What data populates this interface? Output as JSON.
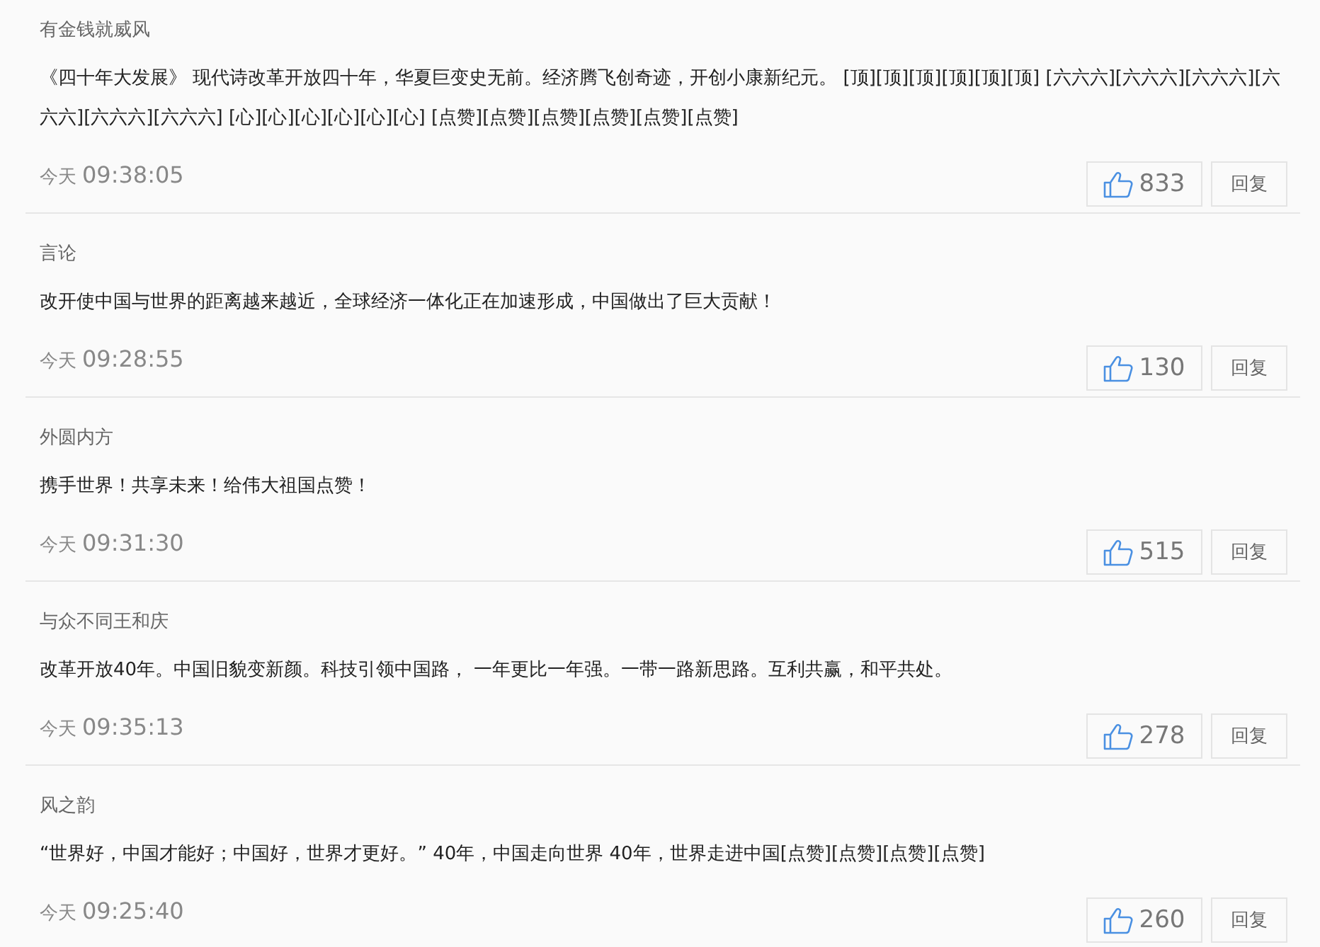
{
  "comments": [
    {
      "user": "有金钱就威风",
      "text": "《四十年大发展》 现代诗改革开放四十年，华夏巨变史无前。经济腾飞创奇迹，开创小康新纪元。 [顶][顶][顶][顶][顶][顶] [六六六][六六六][六六六][六六六][六六六][六六六] [心][心][心][心][心][心] [点赞][点赞][点赞][点赞][点赞][点赞]",
      "day": "今天",
      "time": "09:38:05",
      "likes": "833",
      "reply": "回复"
    },
    {
      "user": "言论",
      "text": "改开使中国与世界的距离越来越近，全球经济一体化正在加速形成，中国做出了巨大贡献！",
      "day": "今天",
      "time": "09:28:55",
      "likes": "130",
      "reply": "回复"
    },
    {
      "user": "外圆内方",
      "text": "携手世界！共享未来！给伟大祖国点赞！",
      "day": "今天",
      "time": "09:31:30",
      "likes": "515",
      "reply": "回复"
    },
    {
      "user": "与众不同王和庆",
      "text": "改革开放40年。中国旧貌变新颜。科技引领中国路， 一年更比一年强。一带一路新思路。互利共赢，和平共处。",
      "day": "今天",
      "time": "09:35:13",
      "likes": "278",
      "reply": "回复"
    },
    {
      "user": "风之韵",
      "text": "“世界好，中国才能好；中国好，世界才更好。” 40年，中国走向世界 40年，世界走进中国[点赞][点赞][点赞][点赞]",
      "day": "今天",
      "time": "09:25:40",
      "likes": "260",
      "reply": "回复"
    }
  ]
}
